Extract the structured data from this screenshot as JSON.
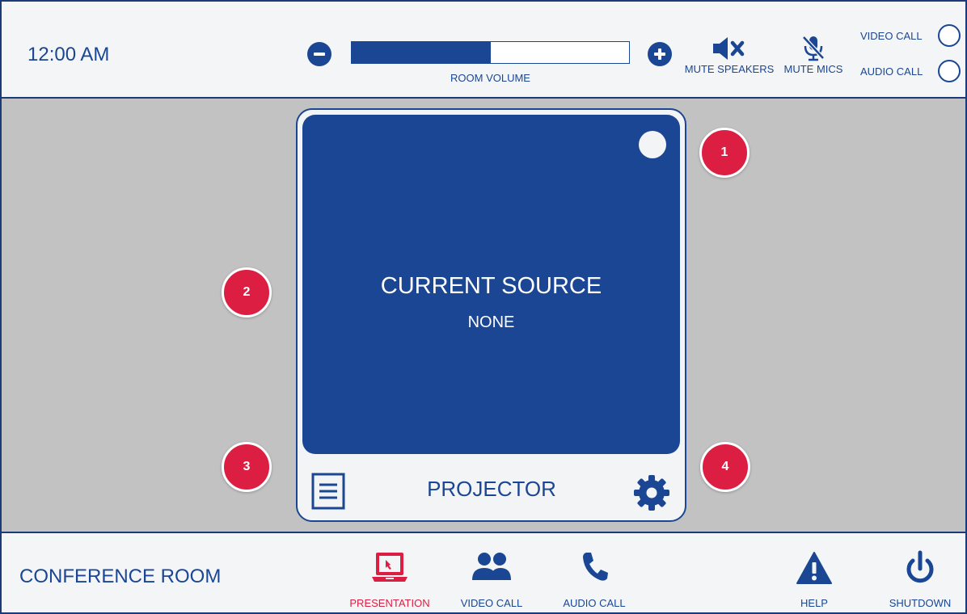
{
  "header": {
    "clock": "12:00 AM",
    "volume": {
      "label": "ROOM VOLUME",
      "level_fraction": 0.5
    },
    "mute_speakers_label": "MUTE SPEAKERS",
    "mute_mics_label": "MUTE MICS",
    "video_call_toggle_label": "VIDEO CALL",
    "audio_call_toggle_label": "AUDIO CALL"
  },
  "card": {
    "source_title": "CURRENT SOURCE",
    "source_value": "NONE",
    "display_name": "PROJECTOR"
  },
  "badges": [
    "1",
    "2",
    "3",
    "4"
  ],
  "footer": {
    "room_name": "CONFERENCE ROOM",
    "nav": [
      {
        "label": "PRESENTATION",
        "icon": "laptop-icon",
        "active": true
      },
      {
        "label": "VIDEO CALL",
        "icon": "people-icon",
        "active": false
      },
      {
        "label": "AUDIO CALL",
        "icon": "phone-icon",
        "active": false
      },
      {
        "label": "HELP",
        "icon": "warning-icon",
        "active": false
      },
      {
        "label": "SHUTDOWN",
        "icon": "power-icon",
        "active": false
      }
    ]
  },
  "colors": {
    "primary": "#1a4693",
    "accent_active": "#dd1e43",
    "background_main": "#c2c2c2",
    "panel": "#f3f4f6"
  },
  "icons": [
    "minus-icon",
    "plus-icon",
    "speaker-mute-icon",
    "mic-mute-icon",
    "list-icon",
    "gear-icon"
  ]
}
